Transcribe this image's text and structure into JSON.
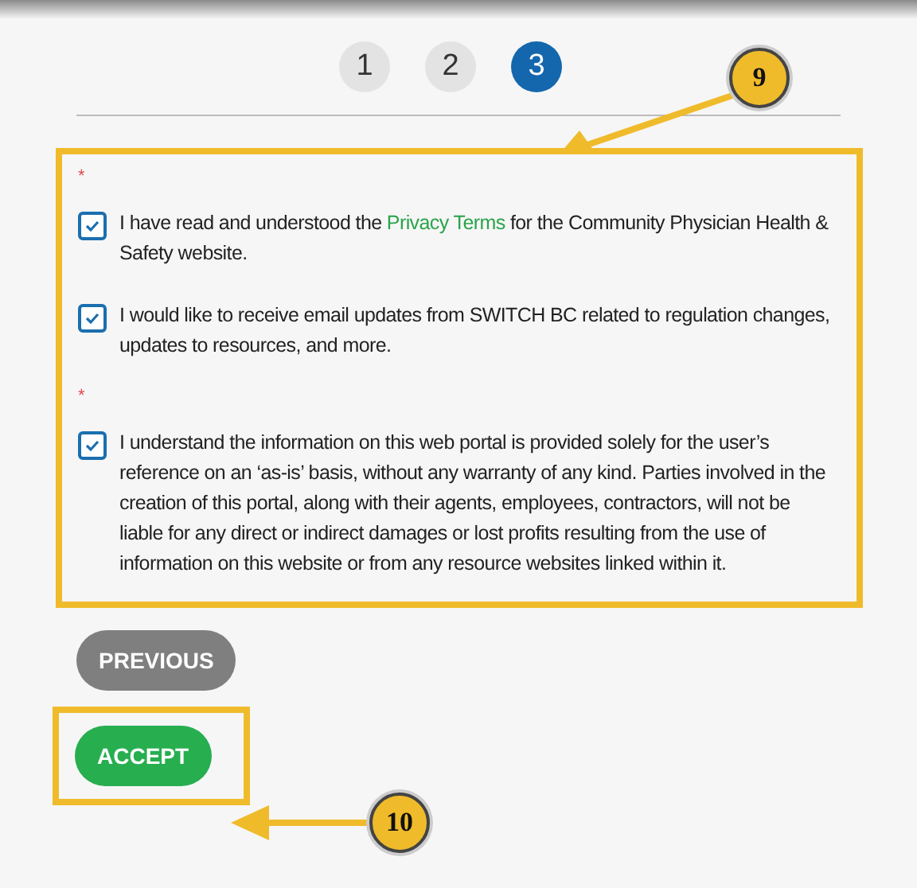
{
  "steps": [
    {
      "label": "1",
      "selected": false
    },
    {
      "label": "2",
      "selected": false
    },
    {
      "label": "3",
      "selected": true
    }
  ],
  "consent_groups": [
    {
      "required": true,
      "mark": "*",
      "items": [
        {
          "checked": true,
          "text_before": "I have read and understood the ",
          "link": "Privacy Terms",
          "text_after": " for the Community Physician Health & Safety website."
        },
        {
          "checked": true,
          "text_before": "I would like to receive email updates from SWITCH BC related to regulation changes, updates to resources, and more."
        }
      ]
    },
    {
      "required": true,
      "mark": "*",
      "items": [
        {
          "checked": true,
          "text_before": "I understand the information on this web portal is provided solely for the user’s reference on an ‘as-is’ basis, without any warranty of any kind. Parties involved in the creation of this portal, along with their agents, employees, contractors, will not be liable for any direct or indirect damages or lost profits resulting from the use of information on this website or from any resource websites linked within it."
        }
      ]
    }
  ],
  "buttons": [
    {
      "label": "PREVIOUS",
      "kind": "secondary"
    },
    {
      "label": "ACCEPT",
      "kind": "primary"
    }
  ],
  "annotations": [
    {
      "label": "9"
    },
    {
      "label": "10"
    }
  ]
}
